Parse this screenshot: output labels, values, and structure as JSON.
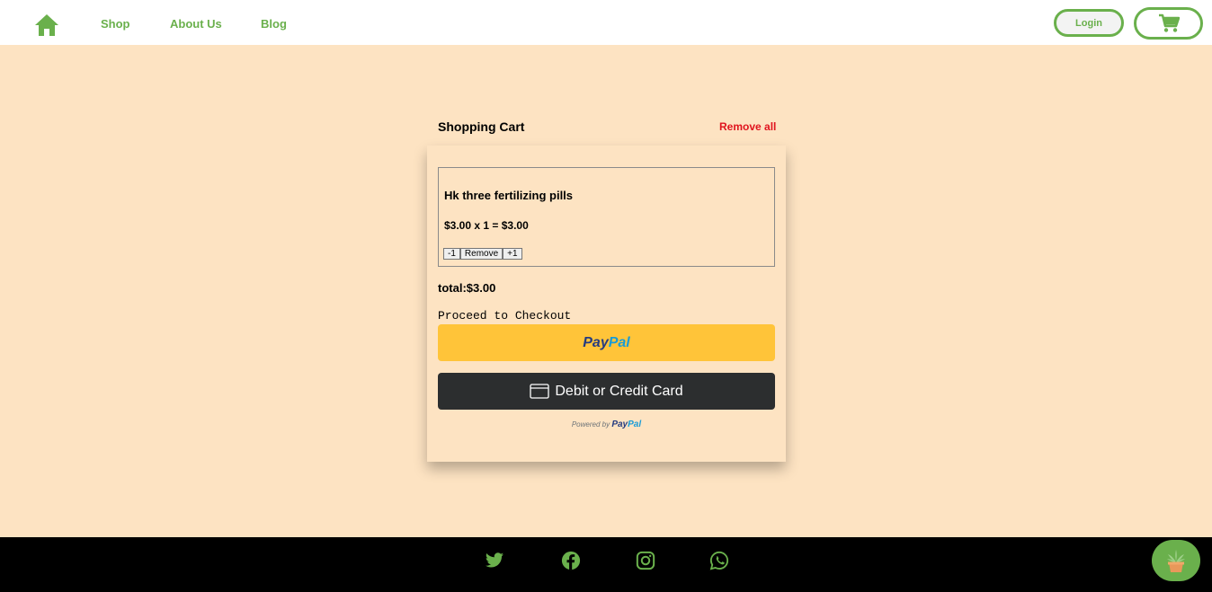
{
  "navbar": {
    "home_icon": "home-icon",
    "links": [
      "Shop",
      "About Us",
      "Blog"
    ],
    "login_label": "Login",
    "cart_icon": "shopping-cart-icon"
  },
  "cart": {
    "title": "Shopping Cart",
    "remove_all_label": "Remove all",
    "items": [
      {
        "name": "Hk three fertilizing pills",
        "price_line": "$3.00 x 1 = $3.00",
        "decrement_label": "-1",
        "remove_label": "Remove",
        "increment_label": "+1"
      }
    ],
    "total": "total:$3.00",
    "checkout_label": "Proceed to Checkout",
    "paypal": {
      "logo_dark": "Pay",
      "logo_light": "Pal",
      "card_button_label": "Debit or Credit Card",
      "powered_by": "Powered by"
    }
  },
  "footer": {
    "social_icons": [
      "twitter-icon",
      "facebook-icon",
      "instagram-icon",
      "whatsapp-icon"
    ]
  },
  "floating_button_icon": "plant-pot-icon",
  "colors": {
    "accent": "#6ab04c",
    "background": "#fde3c2",
    "danger": "#e0141e",
    "paypal_yellow": "#ffc439",
    "card_dark": "#2c2e2f",
    "footer": "#000000"
  }
}
